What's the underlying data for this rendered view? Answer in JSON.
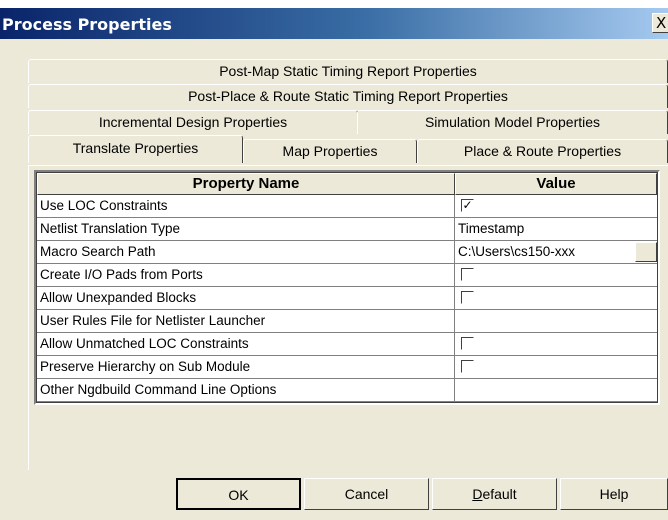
{
  "window": {
    "title": "Process Properties",
    "close_label": "X"
  },
  "tabs": {
    "row1": [
      {
        "label": "Post-Map Static Timing Report Properties"
      }
    ],
    "row2": [
      {
        "label": "Post-Place & Route Static Timing Report Properties"
      }
    ],
    "row3": [
      {
        "label": "Incremental Design Properties"
      },
      {
        "label": "Simulation Model Properties"
      }
    ],
    "row4": [
      {
        "label": "Translate Properties",
        "active": true
      },
      {
        "label": "Map Properties"
      },
      {
        "label": "Place & Route Properties"
      }
    ]
  },
  "grid": {
    "columns": [
      "Property Name",
      "Value"
    ],
    "rows": [
      {
        "name": "Use LOC Constraints",
        "type": "checkbox",
        "checked": true,
        "check_mark": "✓"
      },
      {
        "name": "Netlist Translation Type",
        "type": "text",
        "value": "Timestamp"
      },
      {
        "name": "Macro Search Path",
        "type": "path",
        "value": "C:\\Users\\cs150-xxx"
      },
      {
        "name": "Create I/O Pads from Ports",
        "type": "checkbox",
        "checked": false,
        "check_mark": ""
      },
      {
        "name": "Allow Unexpanded Blocks",
        "type": "checkbox",
        "checked": false,
        "check_mark": ""
      },
      {
        "name": "User Rules File for Netlister Launcher",
        "type": "text",
        "value": ""
      },
      {
        "name": "Allow Unmatched LOC Constraints",
        "type": "checkbox",
        "checked": false,
        "check_mark": ""
      },
      {
        "name": "Preserve Hierarchy on Sub Module",
        "type": "checkbox",
        "checked": false,
        "check_mark": ""
      },
      {
        "name": "Other Ngdbuild Command Line Options",
        "type": "text",
        "value": ""
      }
    ]
  },
  "buttons": {
    "ok": "OK",
    "cancel": "Cancel",
    "default_first": "D",
    "default_rest": "efault",
    "help": "Help"
  },
  "colors": {
    "title_start": "#0a246a",
    "title_end": "#a6caf0",
    "face": "#ece9d8"
  }
}
